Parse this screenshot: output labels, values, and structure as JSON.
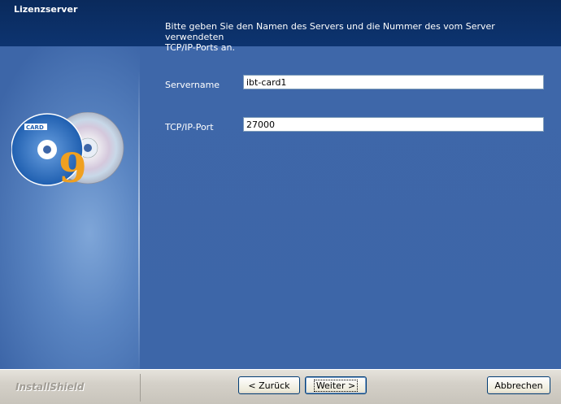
{
  "window": {
    "title": "Lizenzserver"
  },
  "main": {
    "instructions": "Bitte geben Sie den Namen des Servers und die Nummer des vom Server verwendeten\nTCP/IP-Ports an.",
    "fields": {
      "servername": {
        "label": "Servername",
        "value": "ibt-card1"
      },
      "port": {
        "label": "TCP/IP-Port",
        "value": "27000"
      }
    }
  },
  "branding": {
    "installshield": "InstallShield",
    "cd_label": "CARD",
    "cd_number": "9"
  },
  "buttons": {
    "back": "< Zurück",
    "next": "Weiter >",
    "cancel": "Abbrechen"
  },
  "colors": {
    "header": "#0d3470",
    "panel": "#3d66a8",
    "accent": "#f0a020"
  }
}
